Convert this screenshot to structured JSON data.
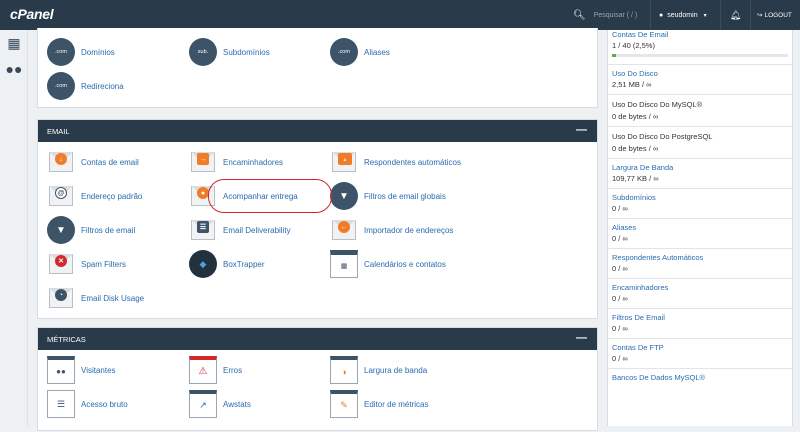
{
  "header": {
    "logo": "cPanel",
    "search_placeholder": "Pesquisar ( / )",
    "username": "seudomin",
    "logout": "LOGOUT"
  },
  "domains_section": {
    "items": [
      {
        "label": "Domínios",
        "icon": "domains-icon",
        "badge": ".com"
      },
      {
        "label": "Subdomínios",
        "icon": "subdomains-icon",
        "badge": "sub."
      },
      {
        "label": "Aliases",
        "icon": "aliases-icon",
        "badge": ".com"
      },
      {
        "label": "Redireciona",
        "icon": "redirects-icon",
        "badge": ".com"
      }
    ]
  },
  "email_section": {
    "title": "EMAIL",
    "items": [
      {
        "label": "Contas de email",
        "icon": "email-accounts-icon"
      },
      {
        "label": "Encaminhadores",
        "icon": "forwarders-icon"
      },
      {
        "label": "Respondentes automáticos",
        "icon": "autoresponders-icon"
      },
      {
        "label": "Endereço padrão",
        "icon": "default-address-icon"
      },
      {
        "label": "Acompanhar entrega",
        "icon": "track-delivery-icon"
      },
      {
        "label": "Filtros de email globais",
        "icon": "global-email-filters-icon"
      },
      {
        "label": "Filtros de email",
        "icon": "email-filters-icon"
      },
      {
        "label": "Email Deliverability",
        "icon": "email-deliverability-icon"
      },
      {
        "label": "Importador de endereços",
        "icon": "address-importer-icon"
      },
      {
        "label": "Spam Filters",
        "icon": "spam-filters-icon"
      },
      {
        "label": "BoxTrapper",
        "icon": "boxtrapper-icon"
      },
      {
        "label": "Calendários e contatos",
        "icon": "calendars-contacts-icon"
      },
      {
        "label": "Email Disk Usage",
        "icon": "email-disk-usage-icon"
      }
    ]
  },
  "metrics_section": {
    "title": "MÉTRICAS",
    "items": [
      {
        "label": "Visitantes",
        "icon": "visitors-icon"
      },
      {
        "label": "Erros",
        "icon": "errors-icon"
      },
      {
        "label": "Largura de banda",
        "icon": "bandwidth-icon"
      },
      {
        "label": "Acesso bruto",
        "icon": "raw-access-icon"
      },
      {
        "label": "Awstats",
        "icon": "awstats-icon"
      },
      {
        "label": "Editor de métricas",
        "icon": "metrics-editor-icon"
      }
    ]
  },
  "stats": [
    {
      "title": "Contas De Email",
      "value": "1 / 40   (2,5%)",
      "progress": 0.025
    },
    {
      "title": "Uso Do Disco",
      "value": "2,51 MB / ∞"
    },
    {
      "title": "Uso Do Disco Do MySQL®",
      "value": "0 de bytes / ∞"
    },
    {
      "title": "Uso Do Disco Do PostgreSQL",
      "value": "0 de bytes / ∞"
    },
    {
      "title": "Largura De Banda",
      "value": "109,77 KB / ∞"
    },
    {
      "title": "Subdomínios",
      "value": "0 / ∞"
    },
    {
      "title": "Aliases",
      "value": "0 / ∞"
    },
    {
      "title": "Respondentes Automáticos",
      "value": "0 / ∞"
    },
    {
      "title": "Encaminhadores",
      "value": "0 / ∞"
    },
    {
      "title": "Filtros De Email",
      "value": "0 / ∞"
    },
    {
      "title": "Contas De FTP",
      "value": "0 / ∞"
    },
    {
      "title": "Bancos De Dados MySQL®",
      "value": ""
    }
  ],
  "colors": {
    "topbar": "#293a4a",
    "link": "#2a6cb0",
    "highlight": "#d0282b",
    "progress": "#4caf50"
  }
}
